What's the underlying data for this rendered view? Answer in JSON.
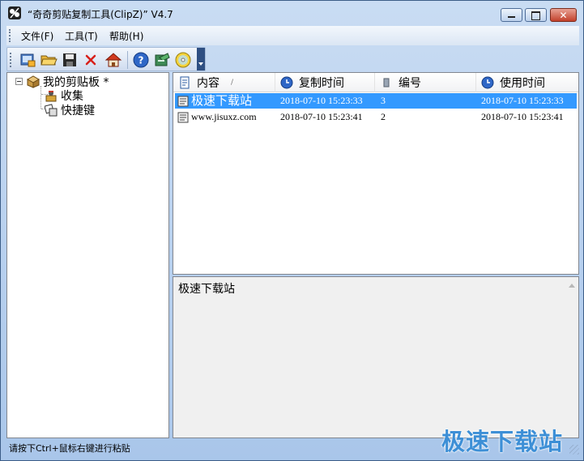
{
  "window": {
    "title": "“奇奇剪贴复制工具(ClipZ)” V4.7"
  },
  "menu": {
    "items": [
      {
        "label": "文件(F)"
      },
      {
        "label": "工具(T)"
      },
      {
        "label": "帮助(H)"
      }
    ]
  },
  "toolbar": {
    "buttons": [
      "new-clip-icon",
      "open-folder-icon",
      "save-icon",
      "delete-icon",
      "home-icon",
      "help-icon",
      "settings-icon",
      "cd-icon"
    ]
  },
  "tree": {
    "root": "我的剪贴板 *",
    "children": [
      "收集",
      "快捷键"
    ]
  },
  "list": {
    "columns": [
      "内容",
      "复制时间",
      "编号",
      "使用时间"
    ],
    "sort_indicator": "/",
    "rows": [
      {
        "content": "极速下载站",
        "copied": "2018-07-10 15:23:33",
        "id": "3",
        "used": "2018-07-10 15:23:33"
      },
      {
        "content": "www.jisuxz.com",
        "copied": "2018-07-10 15:23:41",
        "id": "2",
        "used": "2018-07-10 15:23:41"
      }
    ]
  },
  "preview": {
    "text": "极速下载站"
  },
  "status": {
    "text": "请按下Ctrl+鼠标右键进行粘贴"
  },
  "watermark": "极速下载站",
  "colors": {
    "selection": "#3399ff",
    "title_gradient_top": "#c9dcf3",
    "close_button": "#c2412b"
  }
}
